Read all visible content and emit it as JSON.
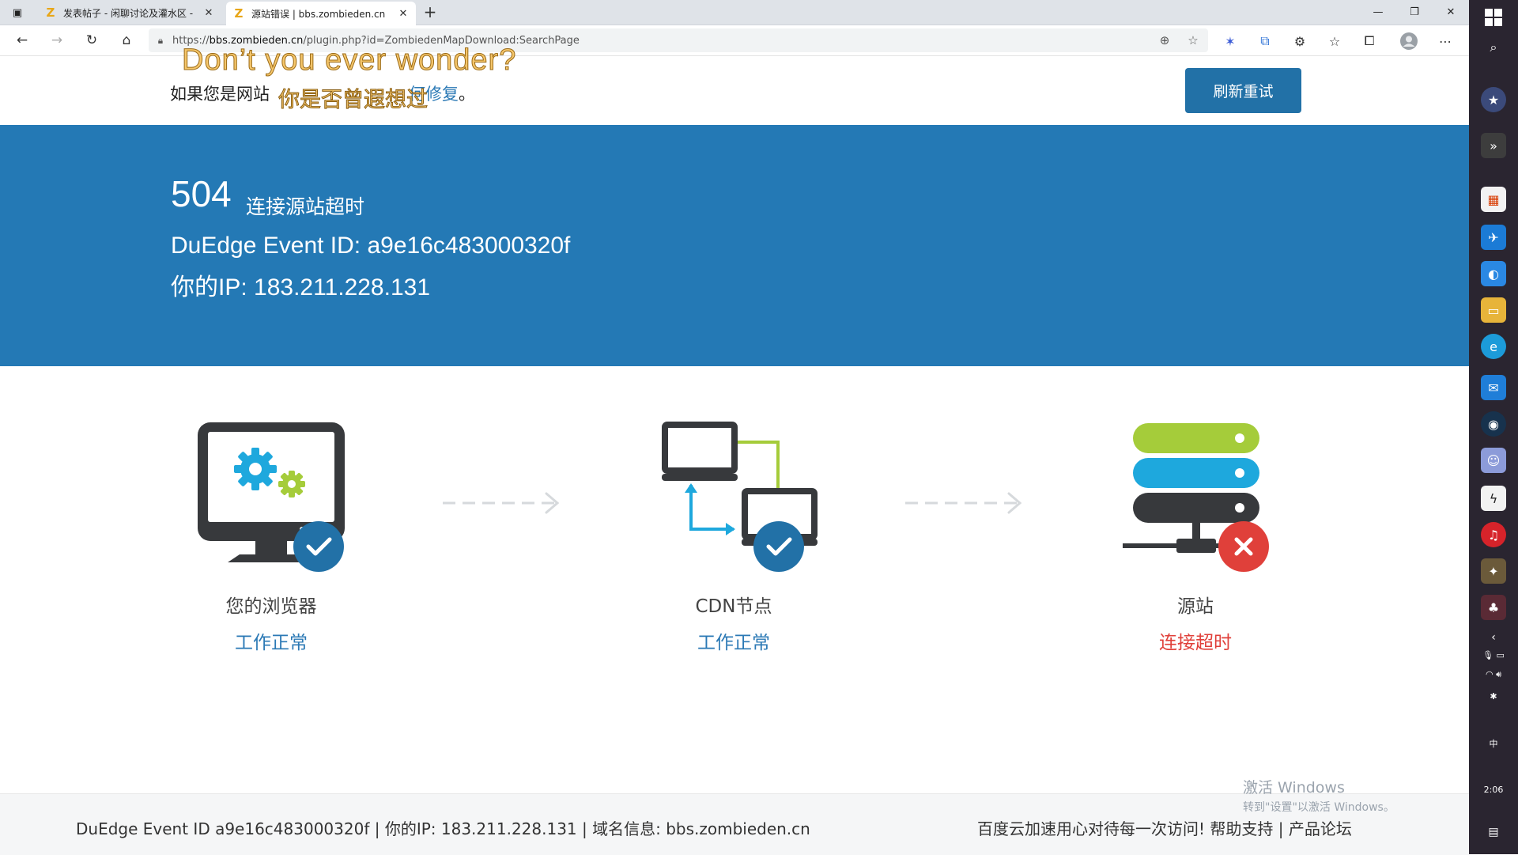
{
  "browser": {
    "tabs": [
      {
        "title": "发表帖子 - 闲聊讨论及灌水区 - ",
        "favicon": "Z",
        "active": false
      },
      {
        "title": "源站错误 | bbs.zombieden.cn",
        "favicon": "Z",
        "active": true
      }
    ],
    "url_prefix": "https://",
    "url_host": "bbs.zombieden.cn",
    "url_path": "/plugin.php?id=ZombiedenMapDownload:SearchPage"
  },
  "page": {
    "notice_prefix": "如果您是网站",
    "notice_link": "何修复",
    "notice_suffix": "。",
    "subtitle_en": "Don’t you ever wonder?",
    "subtitle_zh": "你是否曾遐想过",
    "retry_label": "刷新重试",
    "error": {
      "code": "504",
      "title": "连接源站超时",
      "event_line": "DuEdge Event ID: a9e16c483000320f",
      "ip_line": "你的IP: 183.211.228.131"
    },
    "nodes": [
      {
        "label": "您的浏览器",
        "status": "工作正常",
        "ok": true
      },
      {
        "label": "CDN节点",
        "status": "工作正常",
        "ok": true
      },
      {
        "label": "源站",
        "status": "连接超时",
        "ok": false
      }
    ],
    "footer": {
      "left": "DuEdge Event ID a9e16c483000320f | 你的IP: 183.211.228.131 | 域名信息: bbs.zombieden.cn",
      "right_text": "百度云加速用心对待每一次访问!",
      "help": "帮助支持",
      "separator": "|",
      "forum": "产品论坛"
    },
    "watermark": {
      "line1": "激活 Windows",
      "line2": "转到\"设置\"以激活 Windows。"
    }
  },
  "taskbar": {
    "tray_lang": "中",
    "clock": "2:06"
  },
  "colors": {
    "banner": "#2479b5",
    "primary": "#2271a7",
    "ok": "#2b79b5",
    "error": "#e0403a",
    "green": "#a5cc3a",
    "cyan": "#1ea8dd",
    "dark": "#37393c"
  }
}
